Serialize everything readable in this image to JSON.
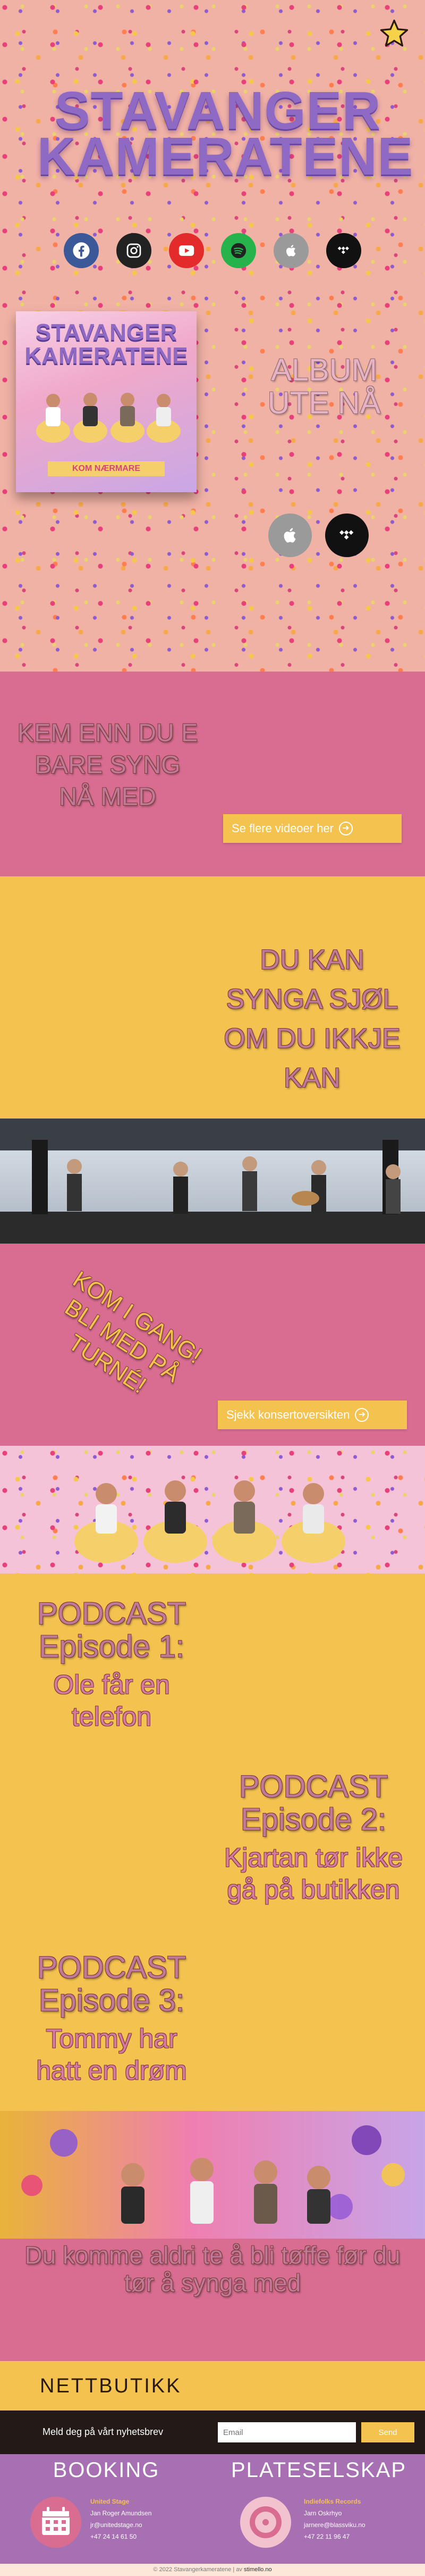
{
  "hero": {
    "title_line1": "STAVANGER",
    "title_line2": "KAMERATENE",
    "social_icons": [
      "facebook-icon",
      "instagram-icon",
      "youtube-icon",
      "spotify-icon",
      "apple-music-icon",
      "tidal-icon"
    ],
    "album": {
      "cover_title_line1": "STAVANGER",
      "cover_title_line2": "KAMERATENE",
      "cover_subtitle": "KOM NÆRMARE",
      "announcement_line1": "ALBUM",
      "announcement_line2": "UTE NÅ",
      "store_icons": [
        "apple-music-icon",
        "tidal-icon"
      ]
    }
  },
  "videos_section": {
    "heading": "KEM ENN DU E BARE SYNG NÅ MED",
    "button_label": "Se flere videoer her"
  },
  "sing_section": {
    "heading": "DU KAN SYNGA SJØL OM DU IKKJE KAN"
  },
  "tour_section": {
    "heading": "KOM I GANG! BLI MED PÅ TURNÉ!",
    "button_label": "Sjekk konsertoversikten"
  },
  "podcasts": [
    {
      "label": "PODCAST",
      "episode": "Episode 1:",
      "title": "Ole får en telefon"
    },
    {
      "label": "PODCAST",
      "episode": "Episode 2:",
      "title": "Kjartan tør ikke gå på butikken"
    },
    {
      "label": "PODCAST",
      "episode": "Episode 3:",
      "title": "Tommy har hatt en drøm"
    }
  ],
  "quote_section": {
    "quote": "Du komme aldri te å bli tøffe før du tør å synga med"
  },
  "shop": {
    "label": "NETTBUTIKK"
  },
  "newsletter": {
    "label": "Meld deg på vårt nyhetsbrev",
    "email_placeholder": "Email",
    "send_label": "Send"
  },
  "contacts": [
    {
      "heading": "BOOKING",
      "icon": "calendar-icon",
      "company": "United Stage",
      "person": "Jan Roger Amundsen",
      "email": "jr@unitedstage.no",
      "phone": "+47 24 14 61 50"
    },
    {
      "heading": "PLATESELSKAP",
      "icon": "vinyl-record-icon",
      "company": "Indiefolks Records",
      "person": "Jarn Oskrhyo",
      "email": "jarnere@blassviku.no",
      "phone": "+47 22 11 96 47"
    }
  ],
  "footer": {
    "copyright": "© 2022 Stavangerkameratene | av",
    "credit": "stimello.no"
  },
  "colors": {
    "pink": "#d86d91",
    "yellow": "#f3c24f",
    "purple": "#a770b2",
    "dark": "#231a17"
  }
}
